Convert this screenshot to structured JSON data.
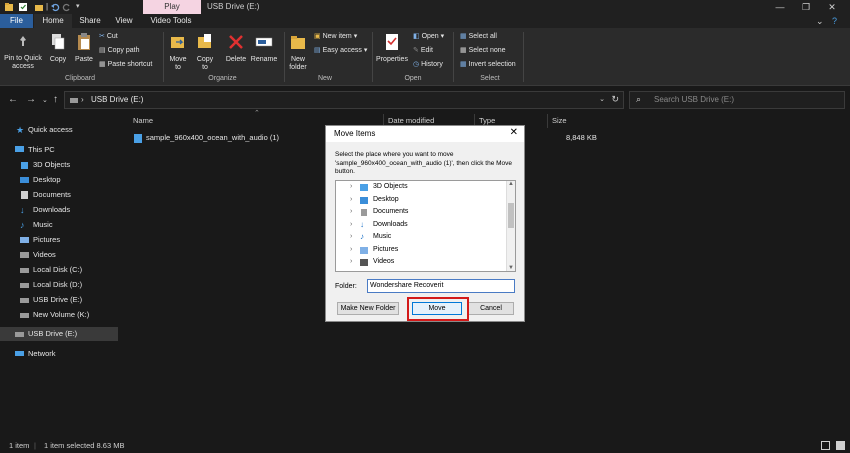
{
  "titlebar": {
    "contextual_tab": "Play",
    "title": "USB Drive (E:)"
  },
  "tabs": [
    "File",
    "Home",
    "Share",
    "View",
    "Video Tools"
  ],
  "ribbon": {
    "clipboard": {
      "pin": "Pin to Quick access",
      "copy": "Copy",
      "paste": "Paste",
      "cut": "Cut",
      "copy_path": "Copy path",
      "paste_shortcut": "Paste shortcut",
      "label": "Clipboard"
    },
    "organize": {
      "move_to": "Move to",
      "copy_to": "Copy to",
      "delete": "Delete",
      "rename": "Rename",
      "label": "Organize"
    },
    "new": {
      "new_folder": "New folder",
      "new_item": "New item",
      "easy_access": "Easy access",
      "label": "New"
    },
    "open": {
      "properties": "Properties",
      "open": "Open",
      "edit": "Edit",
      "history": "History",
      "label": "Open"
    },
    "select": {
      "select_all": "Select all",
      "select_none": "Select none",
      "invert": "Invert selection",
      "label": "Select"
    }
  },
  "address": {
    "path": "USB Drive (E:)",
    "search_placeholder": "Search USB Drive (E:)"
  },
  "nav": {
    "items": [
      "Quick access",
      "This PC",
      "3D Objects",
      "Desktop",
      "Documents",
      "Downloads",
      "Music",
      "Pictures",
      "Videos",
      "Local Disk (C:)",
      "Local Disk (D:)",
      "USB Drive (E:)",
      "New Volume (K:)",
      "USB Drive (E:)",
      "Network"
    ]
  },
  "columns": {
    "name": "Name",
    "date": "Date modified",
    "type": "Type",
    "size": "Size"
  },
  "files": [
    {
      "name": "sample_960x400_ocean_with_audio (1)",
      "size": "8,848 KB"
    }
  ],
  "status": {
    "count": "1 item",
    "selected": "1 item selected  8.63 MB"
  },
  "dialog": {
    "title": "Move Items",
    "description": "Select the place where you want to move 'sample_960x400_ocean_with_audio (1)', then click the Move button.",
    "tree": [
      "3D Objects",
      "Desktop",
      "Documents",
      "Downloads",
      "Music",
      "Pictures",
      "Videos"
    ],
    "folder_label": "Folder:",
    "folder_value": "Wondershare Recoverit",
    "make_new_folder": "Make New Folder",
    "move": "Move",
    "cancel": "Cancel"
  },
  "colors": {
    "file_tab": "#2b5e9c",
    "play_tab": "#f5d4e2",
    "highlight": "#d31a1a",
    "folder_yellow": "#e8b94a"
  }
}
